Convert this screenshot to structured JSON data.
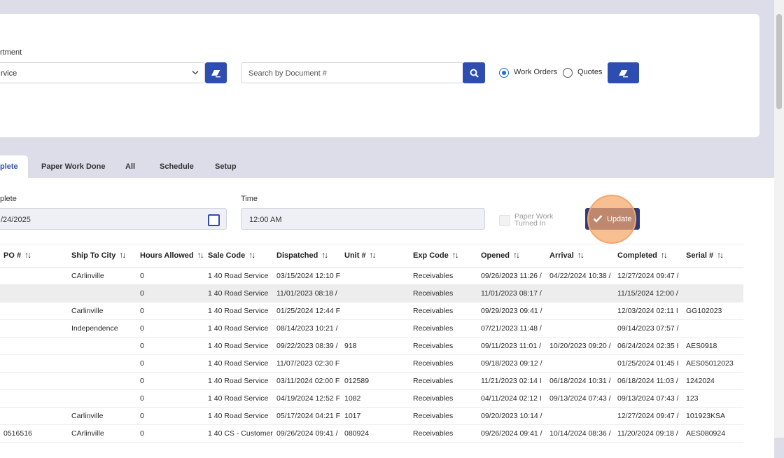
{
  "filters": {
    "department_label": "rtment",
    "department_value": "rvice",
    "search_placeholder": "Search by Document #",
    "radio_work_orders": "Work Orders",
    "radio_quotes": "Quotes"
  },
  "tabs": [
    "plete",
    "Paper Work Done",
    "All",
    "Schedule",
    "Setup"
  ],
  "complete_form": {
    "date_label": "plete",
    "date_value": "/24/2025",
    "time_label": "Time",
    "time_value": "12:00 AM",
    "paperwork_label_line1": "Paper Work",
    "paperwork_label_line2": "Turned In",
    "update_label": "Update"
  },
  "table": {
    "headers": [
      "PO #",
      "Ship To City",
      "Hours Allowed",
      "Sale Code",
      "Dispatched",
      "Unit #",
      "Exp Code",
      "Opened",
      "Arrival",
      "Completed",
      "Serial #"
    ],
    "sort_glyph": "↑↓",
    "rows": [
      [
        "",
        "CArlinville",
        "0",
        "1 40 Road Service",
        "03/15/2024 12:10 F",
        "",
        "Receivables",
        "09/26/2023 11:26 /",
        "04/22/2024 10:38 /",
        "12/27/2024 09:47 /",
        ""
      ],
      [
        "",
        "",
        "0",
        "1 40 Road Service",
        "11/01/2023 08:18 /",
        "",
        "Receivables",
        "11/01/2023 08:17 /",
        "",
        "11/15/2024 12:00 /",
        ""
      ],
      [
        "",
        "Carlinville",
        "0",
        "1 40 Road Service",
        "01/25/2024 12:44 F",
        "",
        "Receivables",
        "09/29/2023 09:41 /",
        "",
        "12/03/2024 02:11 I",
        "GG102023"
      ],
      [
        "",
        "Independence",
        "0",
        "1 40 Road Service",
        "08/14/2023 10:21 /",
        "",
        "Receivables",
        "07/21/2023 11:48 /",
        "",
        "09/14/2023 07:57 /",
        ""
      ],
      [
        "",
        "",
        "0",
        "1 40 Road Service",
        "09/22/2023 08:39 /",
        "918",
        "Receivables",
        "09/11/2023 11:01 /",
        "10/20/2023 09:20 /",
        "06/24/2024 02:35 I",
        "AES0918"
      ],
      [
        "",
        "",
        "0",
        "1 40 Road Service",
        "11/07/2023 02:30 F",
        "",
        "Receivables",
        "09/18/2023 09:12 /",
        "",
        "01/25/2024 01:45 I",
        "AES05012023"
      ],
      [
        "",
        "",
        "0",
        "1 40 Road Service",
        "03/11/2024 02:00 F",
        "012589",
        "Receivables",
        "11/21/2023 02:14 I",
        "06/18/2024 10:31 /",
        "06/18/2024 11:03 /",
        "1242024"
      ],
      [
        "",
        "",
        "0",
        "1 40 Road Service",
        "04/19/2024 12:52 F",
        "1082",
        "Receivables",
        "04/11/2024 02:12 I",
        "09/13/2024 07:43 /",
        "09/13/2024 07:43 /",
        "123"
      ],
      [
        "",
        "Carlinville",
        "0",
        "1 40 Road Service",
        "05/17/2024 04:21 F",
        "1017",
        "Receivables",
        "09/20/2023 10:14 /",
        "",
        "12/27/2024 09:47 /",
        "101923KSA"
      ],
      [
        "0516516",
        "CArlinville",
        "0",
        "1 40 CS - Customer",
        "09/26/2024 09:41 /",
        "080924",
        "Receivables",
        "09/26/2024 09:41 /",
        "10/14/2024 08:36 /",
        "11/20/2024 09:18 /",
        "AES080924"
      ]
    ]
  },
  "colors": {
    "primary": "#2e4db0",
    "update_button": "#2d3a7c",
    "highlight_ring": "#f5a66a"
  }
}
